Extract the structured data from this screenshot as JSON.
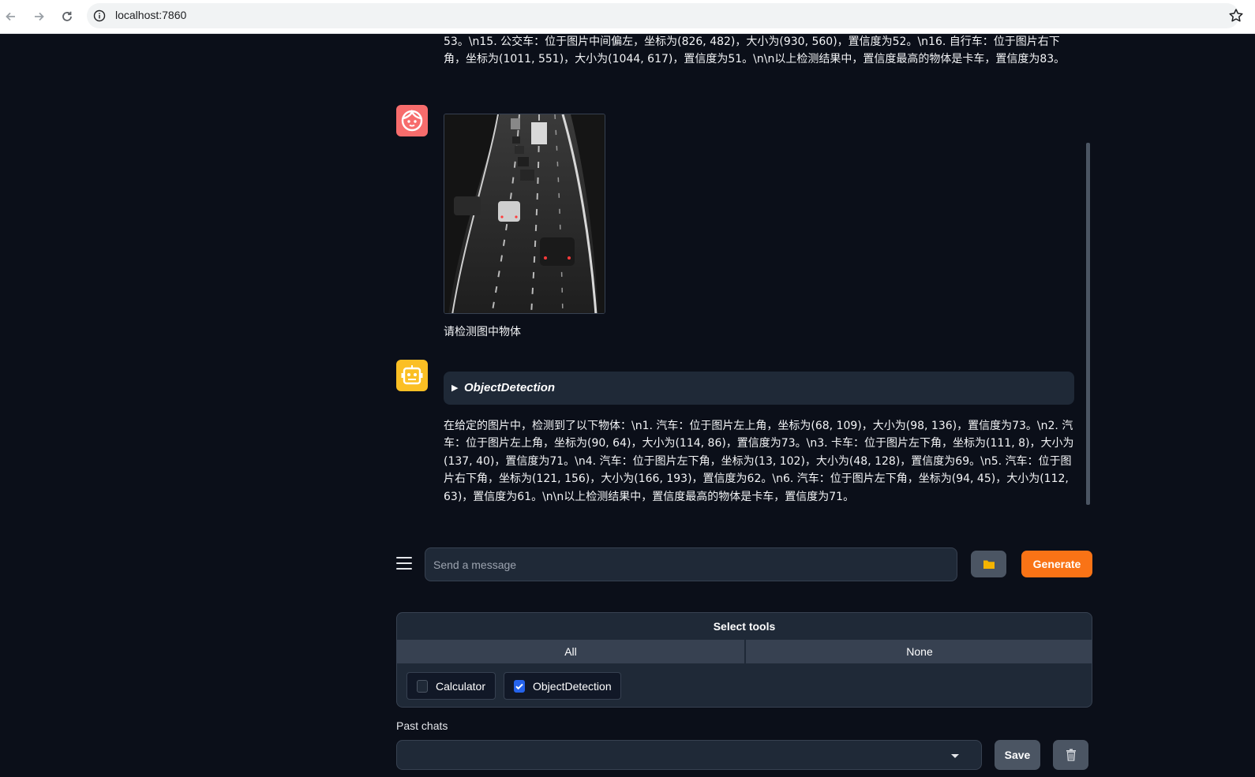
{
  "browser": {
    "url": "localhost:7860"
  },
  "chat": {
    "prev_bot_tail": "53。\\n15. 公交车：位于图片中间偏左，坐标为(826, 482)，大小为(930, 560)，置信度为52。\\n16. 自行车：位于图片右下角，坐标为(1011, 551)，大小为(1044, 617)，置信度为51。\\n\\n以上检测结果中，置信度最高的物体是卡车，置信度为83。",
    "user_message": "请检测图中物体",
    "tool_name": "ObjectDetection",
    "bot_reply": "在给定的图片中，检测到了以下物体：\\n1. 汽车：位于图片左上角，坐标为(68, 109)，大小为(98, 136)，置信度为73。\\n2. 汽车：位于图片左上角，坐标为(90, 64)，大小为(114, 86)，置信度为73。\\n3. 卡车：位于图片左下角，坐标为(111, 8)，大小为(137, 40)，置信度为71。\\n4. 汽车：位于图片左下角，坐标为(13, 102)，大小为(48, 128)，置信度为69。\\n5. 汽车：位于图片右下角，坐标为(121, 156)，大小为(166, 193)，置信度为62。\\n6. 汽车：位于图片左下角，坐标为(94, 45)，大小为(112, 63)，置信度为61。\\n\\n以上检测结果中，置信度最高的物体是卡车，置信度为71。"
  },
  "input": {
    "placeholder": "Send a message",
    "generate_label": "Generate"
  },
  "tools": {
    "title": "Select tools",
    "all_label": "All",
    "none_label": "None",
    "options": [
      {
        "label": "Calculator",
        "checked": false
      },
      {
        "label": "ObjectDetection",
        "checked": true
      }
    ]
  },
  "past_chats": {
    "label": "Past chats",
    "selected": "",
    "save_label": "Save"
  },
  "colors": {
    "background": "#0b0f19",
    "accent": "#f97316",
    "user_avatar": "#f76c6c",
    "bot_avatar": "#fbbf24",
    "checkbox_checked": "#2563eb"
  },
  "icons": [
    "back-arrow-icon",
    "forward-arrow-icon",
    "reload-icon",
    "info-icon",
    "star-icon",
    "user-face-icon",
    "robot-icon",
    "menu-icon",
    "folder-icon",
    "trash-icon",
    "checkmark-icon",
    "caret-down-icon"
  ]
}
